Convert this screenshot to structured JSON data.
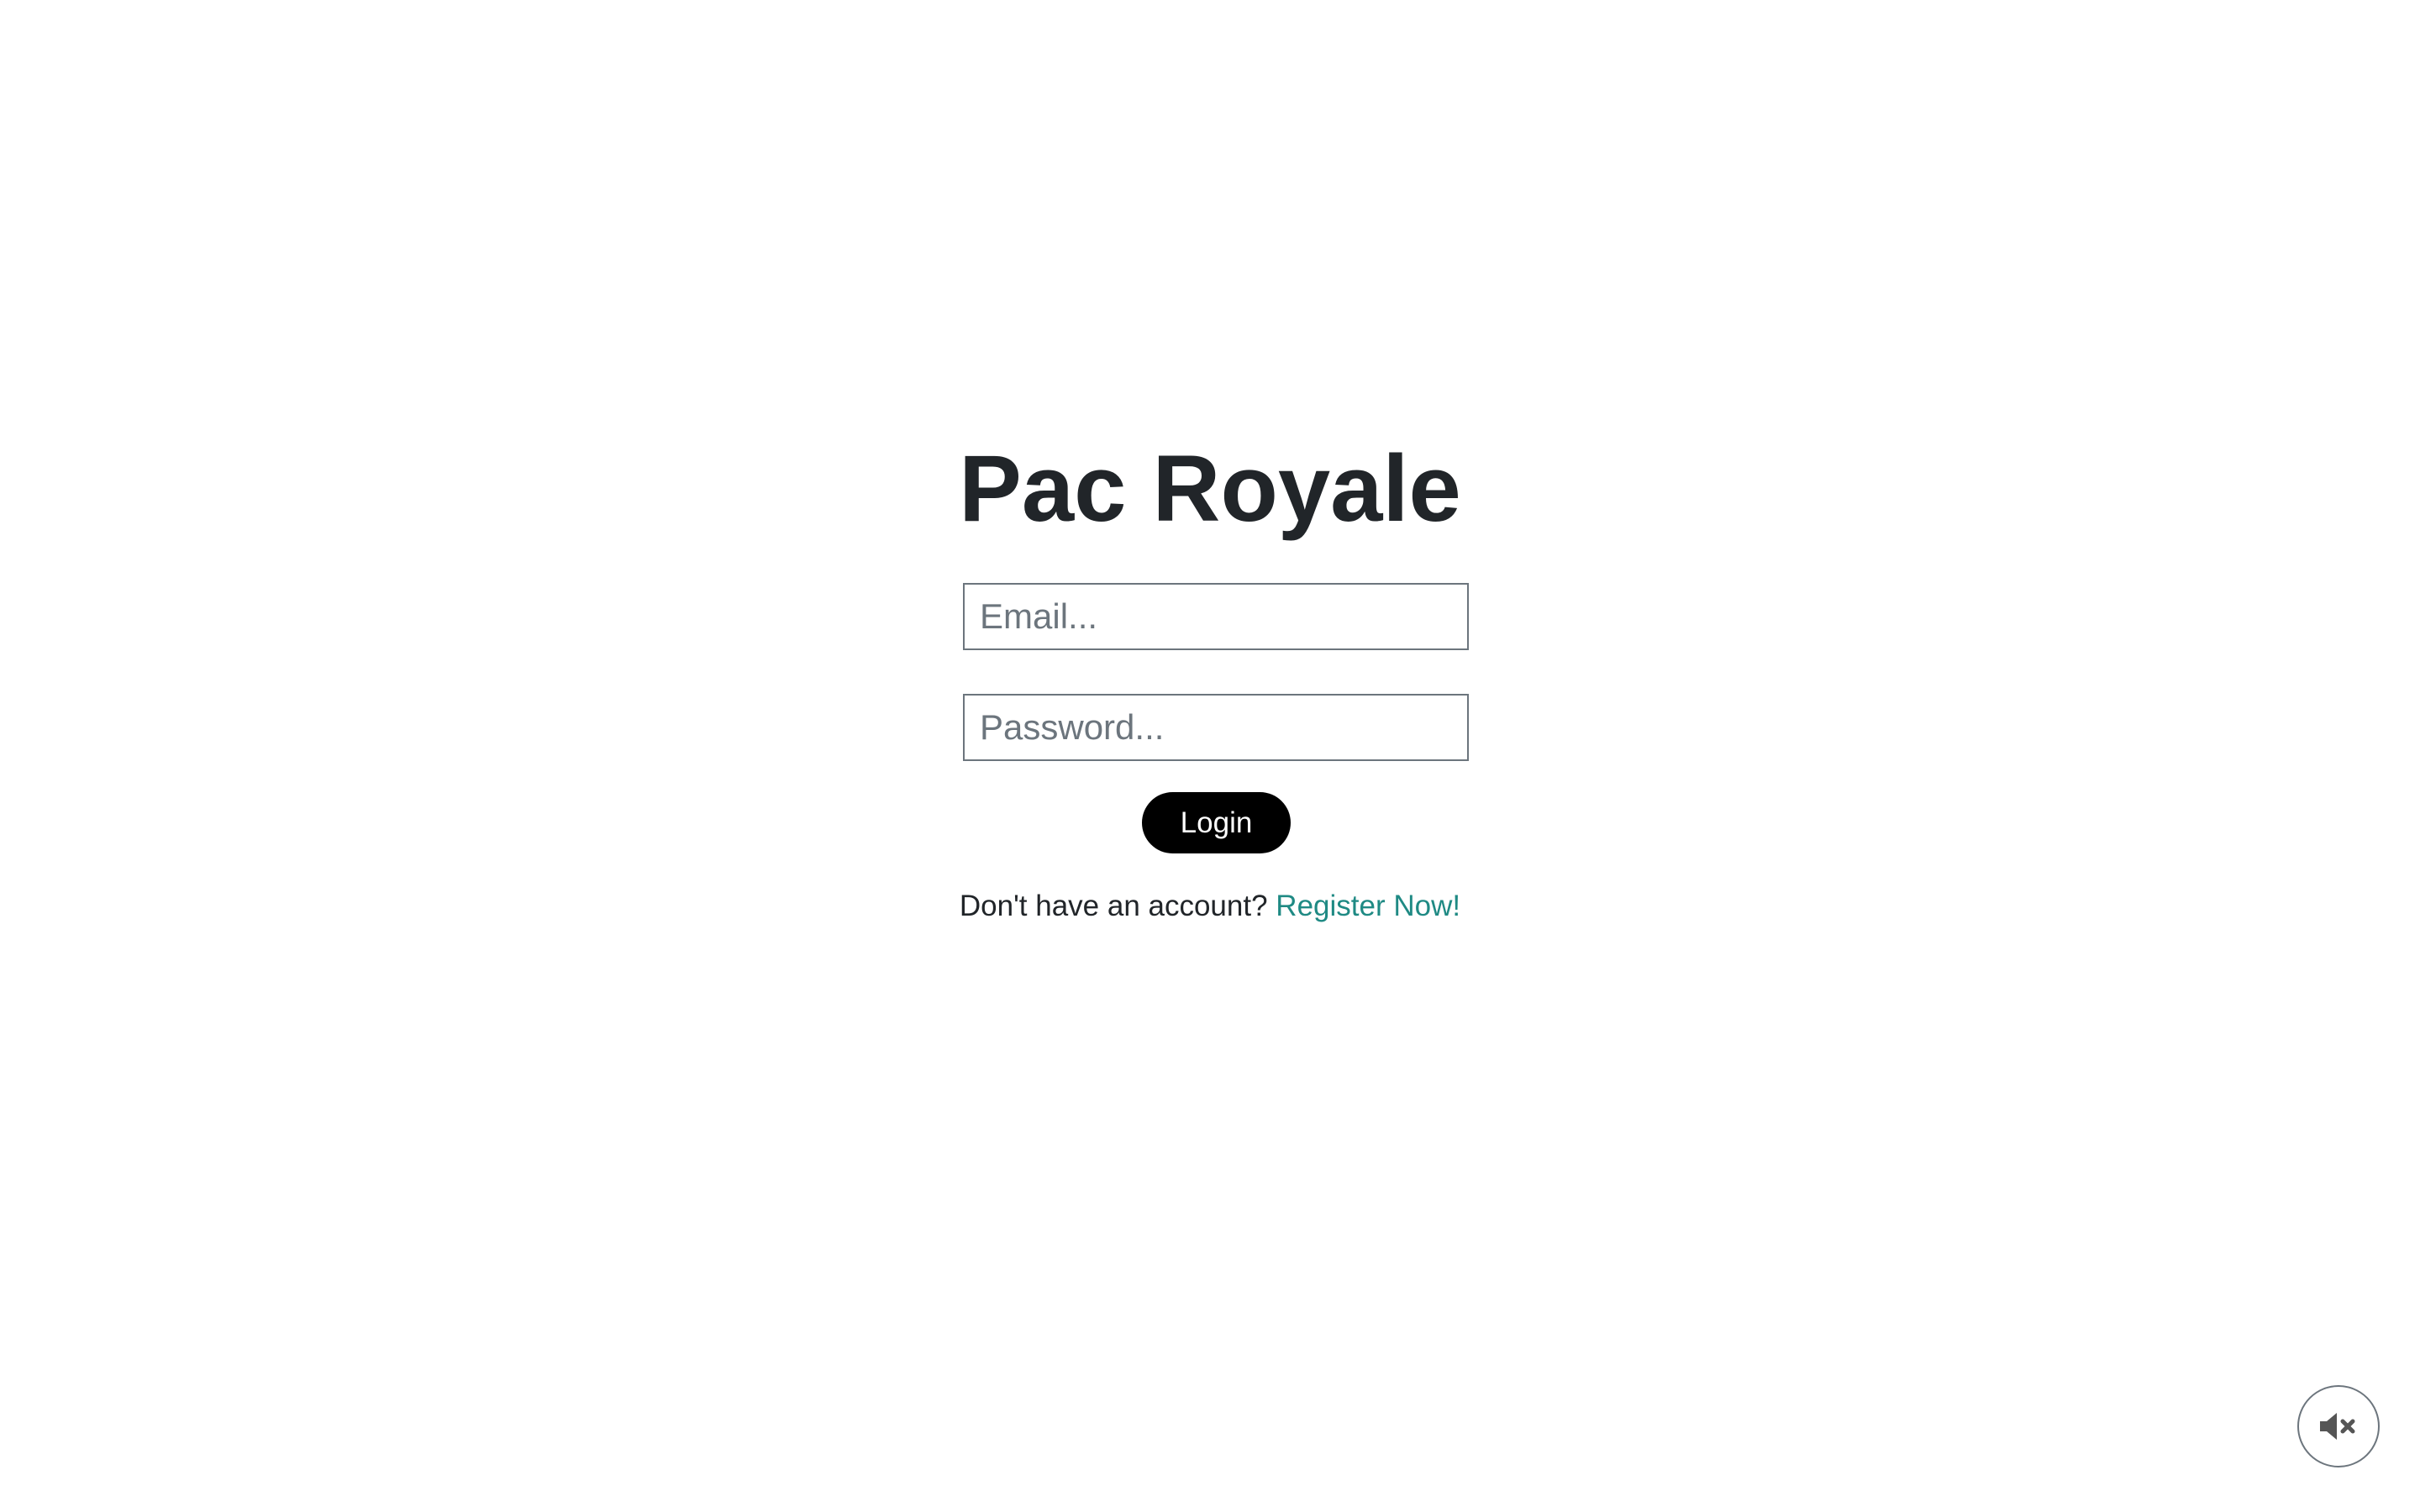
{
  "app": {
    "title": "Pac Royale"
  },
  "login_form": {
    "email_placeholder": "Email...",
    "email_value": "",
    "password_placeholder": "Password...",
    "password_value": "",
    "login_label": "Login",
    "register_prompt": "Don't have an account?",
    "register_link": "Register Now!"
  },
  "sound_toggle": {
    "icon": "speaker-muted-icon"
  },
  "colors": {
    "title": "#212529",
    "button_bg": "#000000",
    "button_text": "#ffffff",
    "link": "#1f8a84",
    "field_border": "#6c757d",
    "background": "#ffffff"
  }
}
